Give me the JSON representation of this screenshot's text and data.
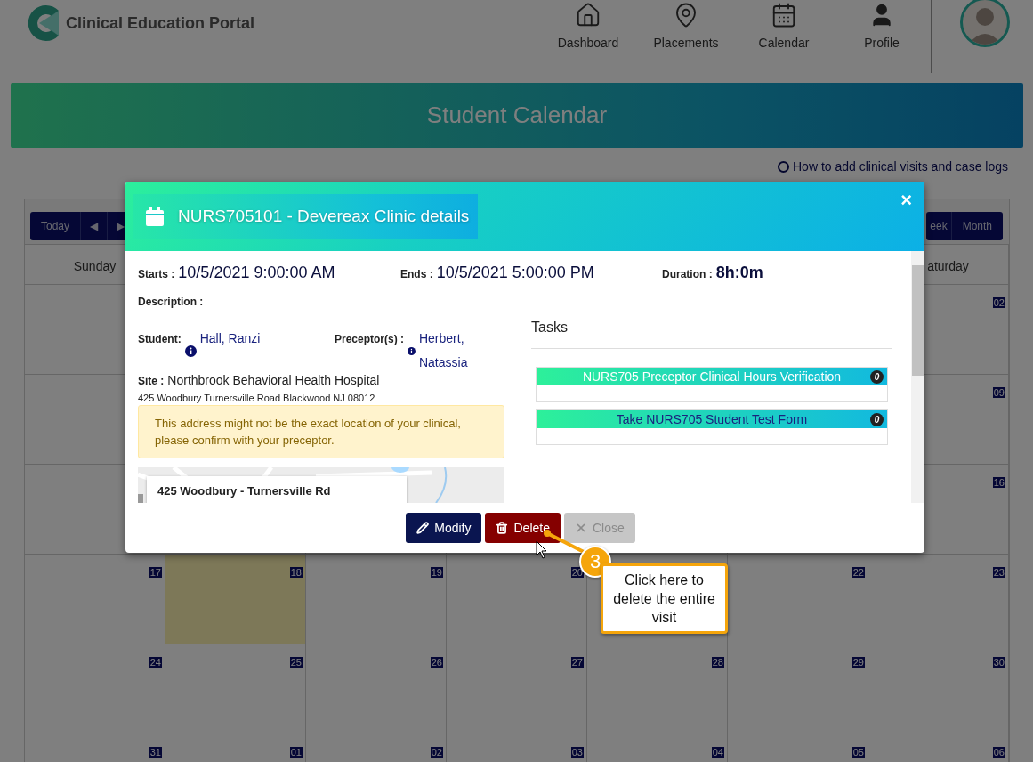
{
  "header": {
    "logo_text": "Clinical Education Portal",
    "nav": [
      {
        "label": "Dashboard",
        "kind": "home"
      },
      {
        "label": "Placements",
        "kind": "pin"
      },
      {
        "label": "Calendar",
        "kind": "calendar"
      },
      {
        "label": "Profile",
        "kind": "person"
      }
    ]
  },
  "banner": {
    "title": "Student Calendar"
  },
  "help_link": "How to add clinical visits and case logs",
  "calendar": {
    "nav_buttons": [
      {
        "label": "Today"
      },
      {
        "label": "◀"
      },
      {
        "label": "▶"
      }
    ],
    "view_buttons": [
      {
        "label": "eek"
      },
      {
        "label": "Month"
      }
    ],
    "weekday_headers": {
      "sunday": "Sunday",
      "saturday": "aturday"
    },
    "weeks": [
      {
        "saturday": {
          "day": "02",
          "today": false
        }
      },
      {
        "saturday": {
          "day": "09",
          "today": false
        }
      },
      {
        "saturday": {
          "day": "16",
          "today": false
        }
      },
      {
        "sunday": {
          "day": "17",
          "today": false
        },
        "monday": {
          "day": "18",
          "today": true
        },
        "tuesday": {
          "day": "19",
          "today": false
        },
        "wednesday": {
          "day": "20",
          "today": false
        },
        "friday": {
          "day": "22",
          "today": false
        },
        "saturday": {
          "day": "23",
          "today": false
        }
      },
      {
        "sunday": {
          "day": "24",
          "today": false
        },
        "monday": {
          "day": "25",
          "today": false
        },
        "tuesday": {
          "day": "26",
          "today": false
        },
        "wednesday": {
          "day": "27",
          "today": false
        },
        "thursday": {
          "day": "28",
          "today": false
        },
        "friday": {
          "day": "29",
          "today": false
        },
        "saturday": {
          "day": "30",
          "today": false
        }
      },
      {
        "sunday": {
          "day": "31",
          "today": false
        },
        "monday": {
          "day": "01",
          "today": false
        },
        "tuesday": {
          "day": "02",
          "today": false
        },
        "wednesday": {
          "day": "03",
          "today": false
        },
        "thursday": {
          "day": "04",
          "today": false
        },
        "friday": {
          "day": "05",
          "today": false
        },
        "saturday": {
          "day": "06",
          "today": false
        }
      }
    ]
  },
  "modal": {
    "title": "NURS705101 - Devereax Clinic details",
    "close": "×",
    "times": [
      {
        "label": "Starts :",
        "value": "10/5/2021 9:00:00 AM",
        "kind": "plain"
      },
      {
        "label": "Ends :",
        "value": "10/5/2021 5:00:00 PM",
        "kind": "plain"
      },
      {
        "label": "Duration :",
        "value": "8h:0m",
        "kind": "bold"
      }
    ],
    "description_label": "Description :",
    "student": {
      "label": "Student:",
      "value": "Hall, Ranzi"
    },
    "preceptor": {
      "label": "Preceptor(s) :",
      "value": "Herbert, Natassia"
    },
    "site": {
      "label": "Site :",
      "value": "Northbrook Behavioral Health Hospital"
    },
    "address": "425 Woodbury Turnersville Road  Blackwood  NJ 08012",
    "alert": "This address might not be the exact location of your clinical, please confirm with your preceptor.",
    "map": {
      "kind": "picture",
      "card_title": "425 Woodbury - Turnersville Rd"
    },
    "tasks_title": "Tasks",
    "tasks": [
      {
        "title": "NURS705 Preceptor Clinical Hours Verification",
        "count": "0",
        "linked": false
      },
      {
        "title": "Take NURS705 Student Test Form",
        "count": "0",
        "linked": true
      }
    ],
    "buttons": [
      {
        "label": "Modify",
        "kind": "modify",
        "disabled": false
      },
      {
        "label": "Delete",
        "kind": "delete",
        "disabled": false
      },
      {
        "label": "Close",
        "kind": "close",
        "disabled": true
      }
    ]
  },
  "callout": {
    "step": "3",
    "text": "Click here to delete the entire visit"
  }
}
